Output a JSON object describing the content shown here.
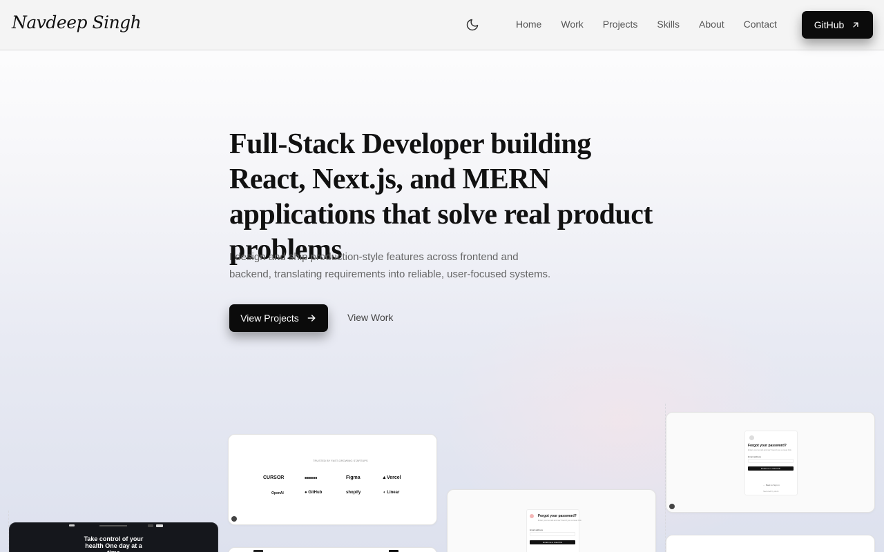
{
  "header": {
    "logo": "Navdeep Singh",
    "theme_toggle_icon": "moon-icon",
    "nav": [
      {
        "label": "Home"
      },
      {
        "label": "Work"
      },
      {
        "label": "Projects"
      },
      {
        "label": "Skills"
      },
      {
        "label": "About"
      },
      {
        "label": "Contact"
      }
    ],
    "github_label": "GitHub",
    "github_icon": "arrow-up-right-icon"
  },
  "hero": {
    "title": "Full-Stack Developer building React, Next.js, and MERN applications that solve real product problems",
    "subtitle": "I design and ship production-style features across frontend and backend, translating requirements into reliable, user-focused systems.",
    "cta_primary": "View Projects",
    "cta_primary_icon": "arrow-right-icon",
    "cta_secondary": "View Work"
  },
  "gallery": {
    "logos_card": {
      "caption": "TRUSTED BY FAST-GROWING STARTUPS",
      "logos": [
        "CURSOR",
        "Figma",
        "Vercel",
        "OpenAI",
        "GitHub",
        "shopify",
        "Linear"
      ]
    },
    "forgot_card_a": {
      "title": "Forgot your password?",
      "text": "Enter your email and we'll send you a reset link.",
      "field_label": "Email address",
      "button": "Email me a reset link",
      "back_link": "← Back to Sign in",
      "footer": "Secured by clerk"
    },
    "forgot_card_b": {
      "title": "Forgot your password?",
      "text": "Enter your email and we'll send you a reset link.",
      "field_label": "Email address",
      "button": "Email me a reset link"
    },
    "health_card": {
      "headline": "Take control of your health One day at a time"
    }
  }
}
